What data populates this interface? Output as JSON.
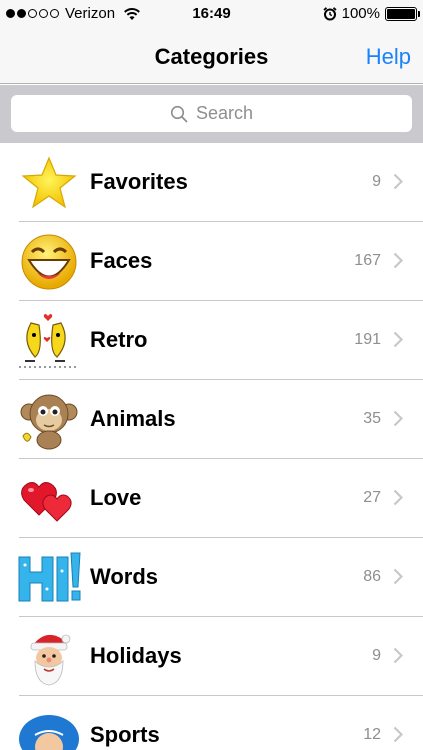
{
  "status_bar": {
    "carrier": "Verizon",
    "time": "16:49",
    "battery": "100%",
    "battery_level": 1.0,
    "signal_bars_filled": 2,
    "signal_bars_total": 5
  },
  "nav": {
    "title": "Categories",
    "help_label": "Help",
    "accent_color": "#1a82fb"
  },
  "search": {
    "placeholder": "Search"
  },
  "categories": [
    {
      "label": "Favorites",
      "count": "9",
      "icon": "star-icon"
    },
    {
      "label": "Faces",
      "count": "167",
      "icon": "laughing-face-icon"
    },
    {
      "label": "Retro",
      "count": "191",
      "icon": "dancing-bananas-icon"
    },
    {
      "label": "Animals",
      "count": "35",
      "icon": "monkey-icon"
    },
    {
      "label": "Love",
      "count": "27",
      "icon": "hearts-icon"
    },
    {
      "label": "Words",
      "count": "86",
      "icon": "hi-word-icon"
    },
    {
      "label": "Holidays",
      "count": "9",
      "icon": "santa-icon"
    },
    {
      "label": "Sports",
      "count": "12",
      "icon": "sports-face-icon"
    }
  ]
}
